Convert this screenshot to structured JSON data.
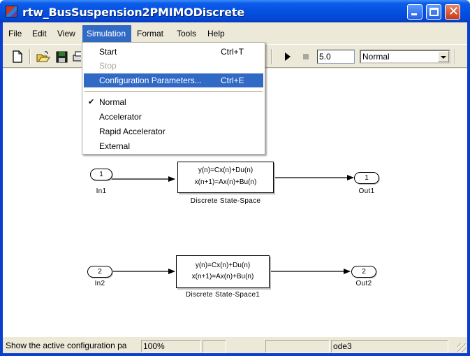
{
  "window": {
    "title": "rtw_BusSuspension2PMIMODiscrete",
    "controls": [
      "minimize",
      "maximize",
      "close"
    ]
  },
  "menubar": {
    "items": [
      {
        "label": "File"
      },
      {
        "label": "Edit"
      },
      {
        "label": "View"
      },
      {
        "label": "Simulation",
        "active": true
      },
      {
        "label": "Format"
      },
      {
        "label": "Tools"
      },
      {
        "label": "Help"
      }
    ]
  },
  "simulation_menu": {
    "items": [
      {
        "label": "Start",
        "shortcut": "Ctrl+T",
        "enabled": true
      },
      {
        "label": "Stop",
        "shortcut": "",
        "enabled": false
      },
      {
        "label": "Configuration Parameters...",
        "shortcut": "Ctrl+E",
        "enabled": true,
        "highlighted": true
      },
      {
        "label": "Normal",
        "checked": true
      },
      {
        "label": "Accelerator"
      },
      {
        "label": "Rapid Accelerator"
      },
      {
        "label": "External"
      }
    ]
  },
  "toolbar": {
    "icons": [
      "new-file-icon",
      "open-folder-icon",
      "save-icon",
      "print-icon",
      "play-icon",
      "stop-icon"
    ],
    "stop_time": "5.0",
    "sim_mode": "Normal"
  },
  "diagram": {
    "blocks": [
      {
        "name": "Discrete State-Space",
        "line1": "y(n)=Cx(n)+Du(n)",
        "line2": "x(n+1)=Ax(n)+Bu(n)"
      },
      {
        "name": "Discrete State-Space1",
        "line1": "y(n)=Cx(n)+Du(n)",
        "line2": "x(n+1)=Ax(n)+Bu(n)"
      }
    ],
    "inports": [
      {
        "number": "1",
        "name": "In1"
      },
      {
        "number": "2",
        "name": "In2"
      }
    ],
    "outports": [
      {
        "number": "1",
        "name": "Out1"
      },
      {
        "number": "2",
        "name": "Out2"
      }
    ]
  },
  "statusbar": {
    "message": "Show the active configuration pa",
    "zoom": "100%",
    "pane3": "",
    "pane4": "",
    "solver": "ode3"
  },
  "colors": {
    "title_blue": "#0550e0",
    "menu_highlight": "#316ac5",
    "face": "#ece9d8"
  }
}
